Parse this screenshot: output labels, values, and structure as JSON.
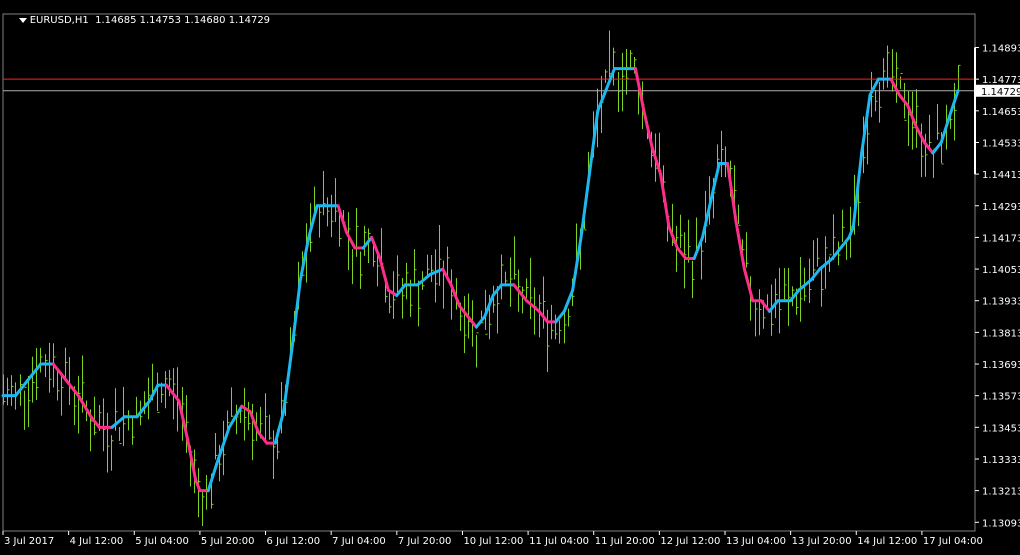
{
  "symbol": "EURUSD,H1",
  "ohlc": "1.14685 1.14753 1.14680 1.14729",
  "colors": {
    "background": "#000000",
    "bars": "#7ed321",
    "up_line": "#1eb8f0",
    "down_line": "#ff2d8a",
    "grid": "#7f7f7f",
    "text": "#ffffff",
    "ask_line": "#ff2020",
    "bid_line": "#b0b0b0",
    "axis": "#ffffff"
  },
  "chart_data": {
    "type": "line",
    "x_tick_labels": [
      "3 Jul 2017",
      "4 Jul 12:00",
      "5 Jul 04:00",
      "5 Jul 20:00",
      "6 Jul 12:00",
      "7 Jul 04:00",
      "7 Jul 20:00",
      "10 Jul 12:00",
      "11 Jul 04:00",
      "11 Jul 20:00",
      "12 Jul 12:00",
      "13 Jul 04:00",
      "13 Jul 20:00",
      "14 Jul 12:00",
      "17 Jul 04:00"
    ],
    "y_tick_labels": [
      "1.14893",
      "1.14773",
      "1.14653",
      "1.14533",
      "1.14413",
      "1.14293",
      "1.14173",
      "1.14053",
      "1.13933",
      "1.13813",
      "1.13693",
      "1.13573",
      "1.13453",
      "1.13333",
      "1.13213",
      "1.13093"
    ],
    "ylim": [
      1.1306,
      1.1502
    ],
    "ask": 1.14773,
    "bid": 1.14729,
    "bid_label": "1.14729",
    "line": [
      [
        0,
        1.13573
      ],
      [
        6,
        1.13573
      ],
      [
        12,
        1.13633
      ],
      [
        18,
        1.13693
      ],
      [
        24,
        1.13693
      ],
      [
        30,
        1.13633
      ],
      [
        36,
        1.13573
      ],
      [
        42,
        1.13493
      ],
      [
        46,
        1.13453
      ],
      [
        52,
        1.13453
      ],
      [
        58,
        1.13493
      ],
      [
        64,
        1.13493
      ],
      [
        70,
        1.13553
      ],
      [
        74,
        1.13613
      ],
      [
        78,
        1.13613
      ],
      [
        84,
        1.13553
      ],
      [
        88,
        1.13413
      ],
      [
        92,
        1.13253
      ],
      [
        94,
        1.13213
      ],
      [
        98,
        1.13213
      ],
      [
        102,
        1.13313
      ],
      [
        108,
        1.13453
      ],
      [
        114,
        1.13533
      ],
      [
        118,
        1.13513
      ],
      [
        122,
        1.13433
      ],
      [
        126,
        1.13393
      ],
      [
        130,
        1.13393
      ],
      [
        134,
        1.13513
      ],
      [
        138,
        1.13753
      ],
      [
        142,
        1.14013
      ],
      [
        146,
        1.14173
      ],
      [
        150,
        1.14293
      ],
      [
        160,
        1.14293
      ],
      [
        164,
        1.14193
      ],
      [
        168,
        1.14133
      ],
      [
        172,
        1.14133
      ],
      [
        176,
        1.14173
      ],
      [
        180,
        1.14093
      ],
      [
        184,
        1.13973
      ],
      [
        188,
        1.13953
      ],
      [
        192,
        1.13993
      ],
      [
        198,
        1.13993
      ],
      [
        204,
        1.14033
      ],
      [
        210,
        1.14053
      ],
      [
        214,
        1.13993
      ],
      [
        218,
        1.13913
      ],
      [
        222,
        1.13873
      ],
      [
        226,
        1.13833
      ],
      [
        230,
        1.13873
      ],
      [
        234,
        1.13953
      ],
      [
        238,
        1.13993
      ],
      [
        244,
        1.13993
      ],
      [
        250,
        1.13933
      ],
      [
        256,
        1.13893
      ],
      [
        260,
        1.13853
      ],
      [
        264,
        1.13853
      ],
      [
        268,
        1.13893
      ],
      [
        272,
        1.13973
      ],
      [
        276,
        1.14173
      ],
      [
        280,
        1.14413
      ],
      [
        284,
        1.14653
      ],
      [
        288,
        1.14733
      ],
      [
        292,
        1.14813
      ],
      [
        298,
        1.14813
      ],
      [
        302,
        1.14813
      ],
      [
        306,
        1.14653
      ],
      [
        310,
        1.14513
      ],
      [
        314,
        1.14413
      ],
      [
        318,
        1.14213
      ],
      [
        322,
        1.14133
      ],
      [
        326,
        1.14093
      ],
      [
        330,
        1.14093
      ],
      [
        334,
        1.14173
      ],
      [
        338,
        1.14313
      ],
      [
        342,
        1.14453
      ],
      [
        346,
        1.14453
      ],
      [
        350,
        1.14233
      ],
      [
        354,
        1.14053
      ],
      [
        358,
        1.13933
      ],
      [
        362,
        1.13933
      ],
      [
        366,
        1.13893
      ],
      [
        370,
        1.13933
      ],
      [
        376,
        1.13933
      ],
      [
        380,
        1.13973
      ],
      [
        386,
        1.14013
      ],
      [
        390,
        1.14053
      ],
      [
        396,
        1.14093
      ],
      [
        400,
        1.14133
      ],
      [
        404,
        1.14173
      ],
      [
        406,
        1.14213
      ],
      [
        410,
        1.14493
      ],
      [
        414,
        1.14713
      ],
      [
        418,
        1.14773
      ],
      [
        424,
        1.14773
      ],
      [
        428,
        1.14713
      ],
      [
        432,
        1.14673
      ],
      [
        436,
        1.14593
      ],
      [
        440,
        1.14533
      ],
      [
        444,
        1.14493
      ],
      [
        448,
        1.14533
      ],
      [
        452,
        1.14633
      ],
      [
        456,
        1.14729
      ]
    ]
  }
}
